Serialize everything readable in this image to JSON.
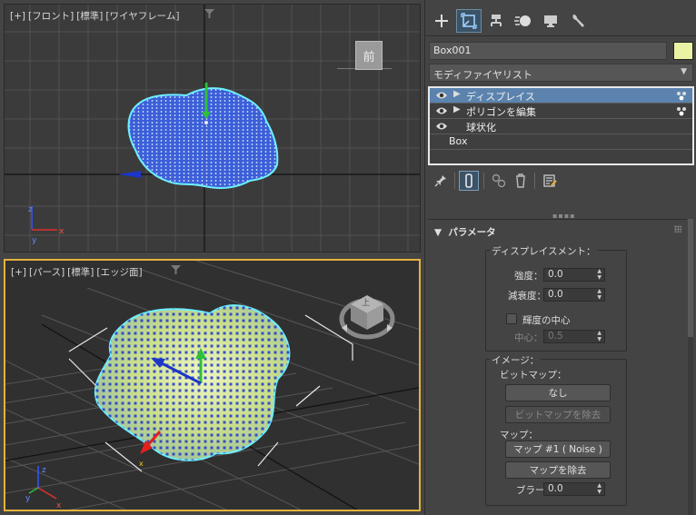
{
  "viewports": {
    "front": {
      "label_plus": "[+]",
      "label_view": "[フロント]",
      "label_mode": "[標準]",
      "label_shading": "[ワイヤフレーム]",
      "viewcube_face": "前"
    },
    "persp": {
      "label_plus": "[+]",
      "label_view": "[パース]",
      "label_mode": "[標準]",
      "label_shading": "[エッジ面]",
      "viewcube_face": "上"
    },
    "axis_x": "x",
    "axis_y": "y",
    "axis_z": "z"
  },
  "command_panel": {
    "tabs": [
      "create",
      "modify",
      "hierarchy",
      "motion",
      "display",
      "utilities"
    ],
    "object_name": "Box001",
    "object_color": "#eaf2a4",
    "modifier_list_label": "モディファイヤリスト",
    "stack": [
      {
        "label": "ディスプレイス",
        "selected": true,
        "has_arrow": true,
        "has_gizmo": true
      },
      {
        "label": "ポリゴンを編集",
        "selected": false,
        "has_arrow": true,
        "has_gizmo": true
      },
      {
        "label": "球状化",
        "selected": false,
        "has_arrow": false,
        "has_gizmo": false
      }
    ],
    "base_object": "Box",
    "accent_color": "#5b83ae"
  },
  "parameters": {
    "title": "パラメータ",
    "displacement_group": "ディスプレイスメント：",
    "strength_label": "強度：",
    "strength_value": "0.0",
    "decay_label": "減衰度：",
    "decay_value": "0.0",
    "luminance_center_label": "輝度の中心",
    "center_label": "中心：",
    "center_value": "0.5",
    "image_group": "イメージ：",
    "bitmap_label": "ビットマップ：",
    "bitmap_button": "なし",
    "remove_bitmap_button": "ビットマップを除去",
    "map_label": "マップ：",
    "map_button": "マップ #1 ( Noise )",
    "remove_map_button": "マップを除去",
    "blur_label": "ブラー：",
    "blur_value": "0.0"
  }
}
